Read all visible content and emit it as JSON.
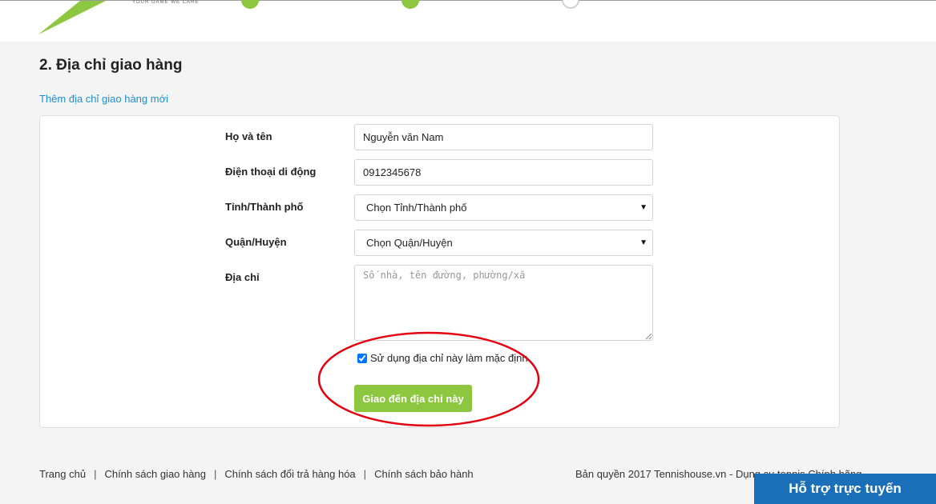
{
  "section": {
    "title": "2. Địa chỉ giao hàng",
    "add_address_link": "Thêm địa chỉ giao hàng mới"
  },
  "form": {
    "name_label": "Họ và tên",
    "name_value": "Nguyễn văn Nam",
    "phone_label": "Điện thoại di động",
    "phone_value": "0912345678",
    "city_label": "Tỉnh/Thành phố",
    "city_selected": "Chọn Tỉnh/Thành phố",
    "district_label": "Quận/Huyện",
    "district_selected": "Chọn Quận/Huyện",
    "address_label": "Địa chỉ",
    "address_placeholder": "Số nhà, tên đường, phường/xã",
    "default_checkbox_label": "Sử dụng địa chỉ này làm mặc định",
    "default_checked": true,
    "submit_label": "Giao đến địa chỉ này"
  },
  "footer": {
    "links": [
      "Trang chủ",
      "Chính sách giao hàng",
      "Chính sách đổi trả hàng hóa",
      "Chính sách bảo hành"
    ],
    "separator": "|",
    "copyright": "Bản quyền 2017 Tennishouse.vn - Dụng cụ tennis Chính hãng"
  },
  "support_button": "Hỗ trợ trực tuyến",
  "colors": {
    "accent_green": "#8dc63f",
    "link_blue": "#1f8ed0",
    "support_blue": "#1a6fb8",
    "annotation_red": "#e4000f"
  },
  "icons": {
    "select_caret": "▼",
    "steps": [
      "step-complete-icon",
      "step-complete-icon",
      "step-pending-icon"
    ]
  }
}
